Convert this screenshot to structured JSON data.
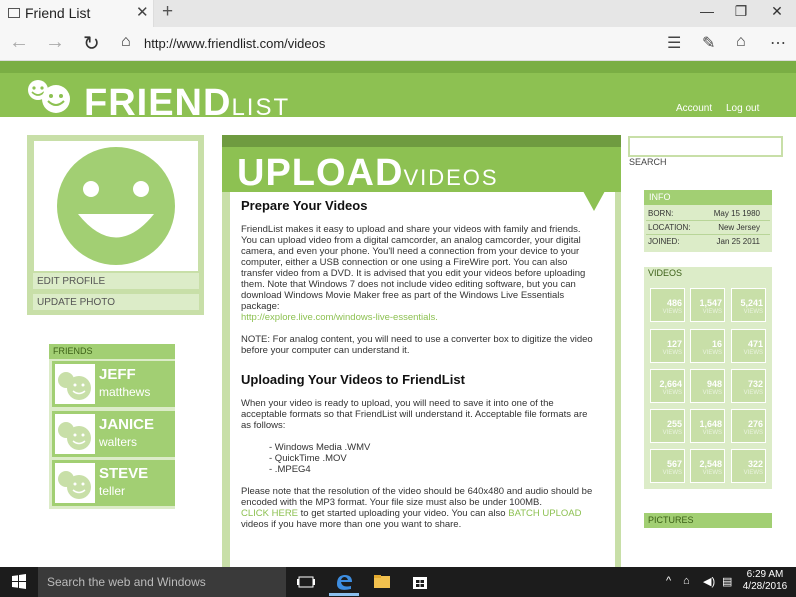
{
  "browser": {
    "tab_title": "Friend List",
    "url": "http://www.friendlist.com/videos"
  },
  "site": {
    "logo_bold": "FRIEND",
    "logo_light": "LIST",
    "nav": {
      "account": "Account",
      "logout": "Log out"
    }
  },
  "sidebar": {
    "edit_profile": "EDIT PROFILE",
    "update_photo": "UPDATE PHOTO",
    "friends_title": "FRIENDS",
    "friends": [
      {
        "first": "JEFF",
        "last": "matthews"
      },
      {
        "first": "JANICE",
        "last": "walters"
      },
      {
        "first": "STEVE",
        "last": "teller"
      }
    ]
  },
  "main": {
    "title_bold": "UPLOAD",
    "title_light": "VIDEOS",
    "h1": "Prepare Your Videos",
    "p1": "FriendList makes it easy to upload and share your videos with family and friends. You can upload video from a digital camcorder, an analog camcorder, your digital camera, and even your phone. You'll need a connection from your device to your computer, either a USB connection or one using a FireWire port. You can also transfer video from a DVD. It is advised that you edit your videos before uploading them. Note that Windows 7 does not include video editing software, but you can download Windows Movie Maker free as part of the Windows Live Essentials package:",
    "p1_link": "http://explore.live.com/windows-live-essentials.",
    "p2": "NOTE: For analog content, you will need to use a converter box to digitize the video before your computer can understand it.",
    "h2": "Uploading Your Videos to FriendList",
    "p3": "When your video is ready to upload, you will need to save it into one of the acceptable formats so that FriendList will understand it. Acceptable file formats are as follows:",
    "formats": [
      "- Windows Media .WMV",
      "- QuickTime .MOV",
      "- .MPEG4"
    ],
    "p4": "Please note that the resolution of the video should be 640x480 and audio should be encoded with the MP3 format. Your file size must also be under 100MB.",
    "click_here": "CLICK HERE",
    "p5_mid": " to get started uploading your video. You can also ",
    "batch_upload": "BATCH UPLOAD",
    "p5_end": " videos if you have more than one you want to share."
  },
  "right": {
    "search_label": "SEARCH",
    "info_title": "INFO",
    "info": [
      {
        "label": "BORN:",
        "value": "May 15 1980"
      },
      {
        "label": "LOCATION:",
        "value": "New Jersey"
      },
      {
        "label": "JOINED:",
        "value": "Jan 25 2011"
      }
    ],
    "videos_title": "VIDEOS",
    "views_label": "VIEWS",
    "videos": [
      "486",
      "1,547",
      "5,241",
      "127",
      "16",
      "471",
      "2,664",
      "948",
      "732",
      "255",
      "1,648",
      "276",
      "567",
      "2,548",
      "322"
    ],
    "pictures_title": "PICTURES"
  },
  "taskbar": {
    "search_placeholder": "Search the web and Windows",
    "time": "6:29 AM",
    "date": "4/28/2016"
  },
  "colors": {
    "brand_green": "#8dc152",
    "light_green": "#c8dfa8",
    "pale_green": "#dcecc8"
  }
}
